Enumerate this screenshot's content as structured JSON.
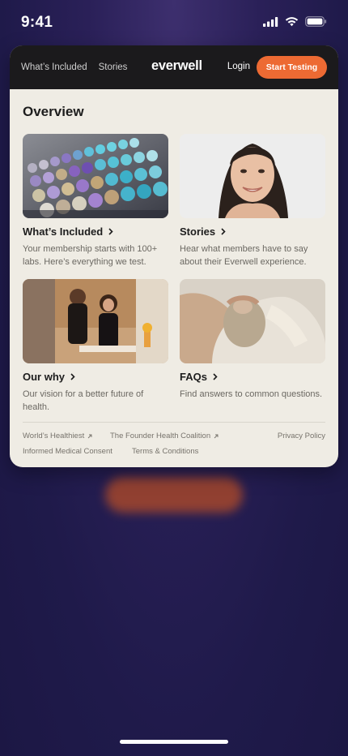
{
  "status": {
    "time": "9:41"
  },
  "nav": {
    "links": [
      "What’s Included",
      "Stories"
    ],
    "logo": "everwell",
    "login": "Login",
    "cta": "Start Testing"
  },
  "overview": {
    "title": "Overview",
    "tiles": [
      {
        "title": "What’s Included",
        "desc": "Your membership starts with 100+ labs. Here’s everything we test."
      },
      {
        "title": "Stories",
        "desc": "Hear what members have to say about their Everwell experience."
      },
      {
        "title": "Our why",
        "desc": "Our vision for a better future of health."
      },
      {
        "title": "FAQs",
        "desc": "Find answers to common questions."
      }
    ]
  },
  "footer": {
    "worlds_healthiest": "World’s Healthiest",
    "founder_coalition": "The Founder Health Coalition",
    "privacy": "Privacy Policy",
    "consent": "Informed Medical Consent",
    "terms": "Terms & Conditions"
  },
  "colors": {
    "accent": "#ed6a33",
    "nav_bg": "#1b1a1c",
    "card_bg": "#efece4"
  }
}
